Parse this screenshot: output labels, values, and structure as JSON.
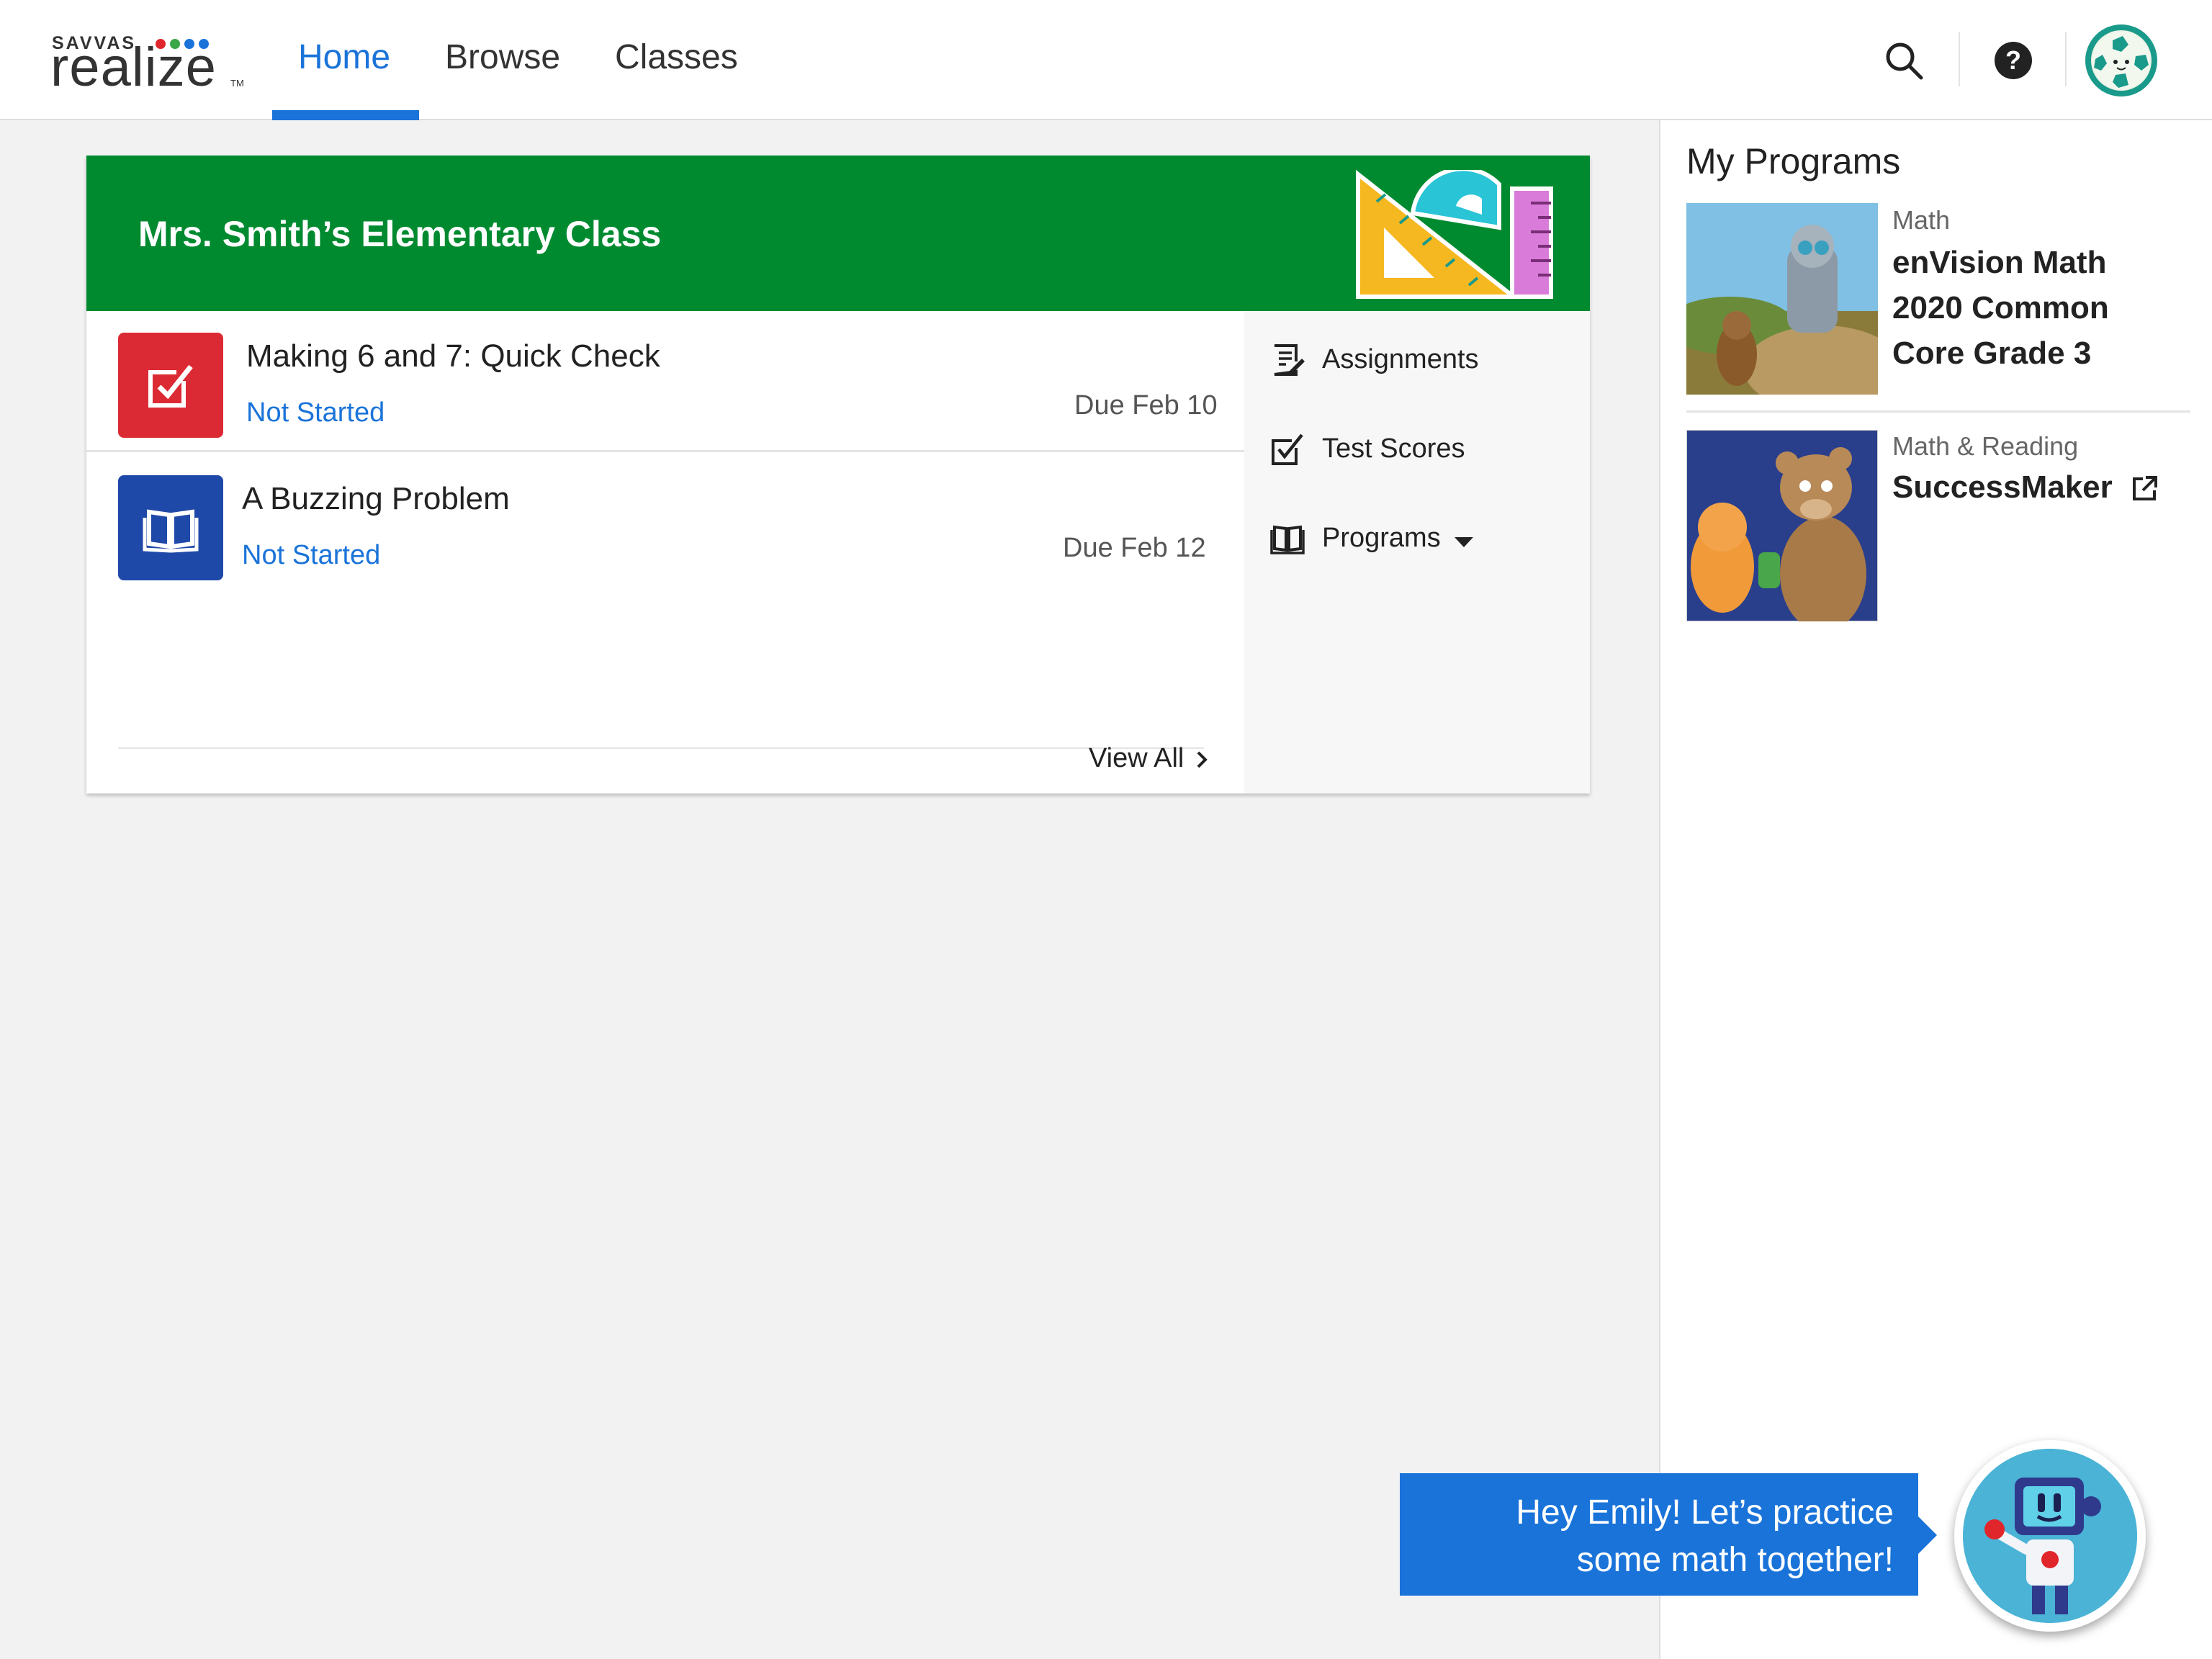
{
  "brand": {
    "top": "SAVVAS",
    "name": "realize",
    "tm": "TM",
    "dot_colors": [
      "#e0262b",
      "#3aa646",
      "#1a73d9",
      "#1a73d9"
    ]
  },
  "nav": {
    "home": "Home",
    "browse": "Browse",
    "classes": "Classes",
    "active_color": "#1a73d9"
  },
  "header_icons": [
    "search-icon",
    "help-icon",
    "avatar"
  ],
  "help_glyph": "?",
  "class_card": {
    "title": "Mrs. Smith’s Elementary Class",
    "header_color": "#008a30",
    "assignments": [
      {
        "title": "Making 6 and 7: Quick Check",
        "status": "Not Started",
        "due": "Due Feb 10",
        "icon": "checkbox-icon",
        "tile_color": "#dc2a34"
      },
      {
        "title": "A Buzzing Problem",
        "status": "Not Started",
        "due": "Due Feb 12",
        "icon": "book-icon",
        "tile_color": "#1f49a8"
      }
    ],
    "view_all": "View All",
    "side_nav": {
      "assignments": "Assignments",
      "test_scores": "Test Scores",
      "programs": "Programs"
    }
  },
  "my_programs": {
    "title": "My Programs",
    "items": [
      {
        "subject": "Math",
        "name_lines": [
          "enVision Math",
          "2020 Common",
          "Core Grade 3"
        ]
      },
      {
        "subject": "Math & Reading",
        "name": "SuccessMaker",
        "external_link": true
      }
    ]
  },
  "chat": {
    "line1": "Hey Emily! Let’s practice",
    "line2": "some math together!",
    "color": "#1a73d9"
  }
}
